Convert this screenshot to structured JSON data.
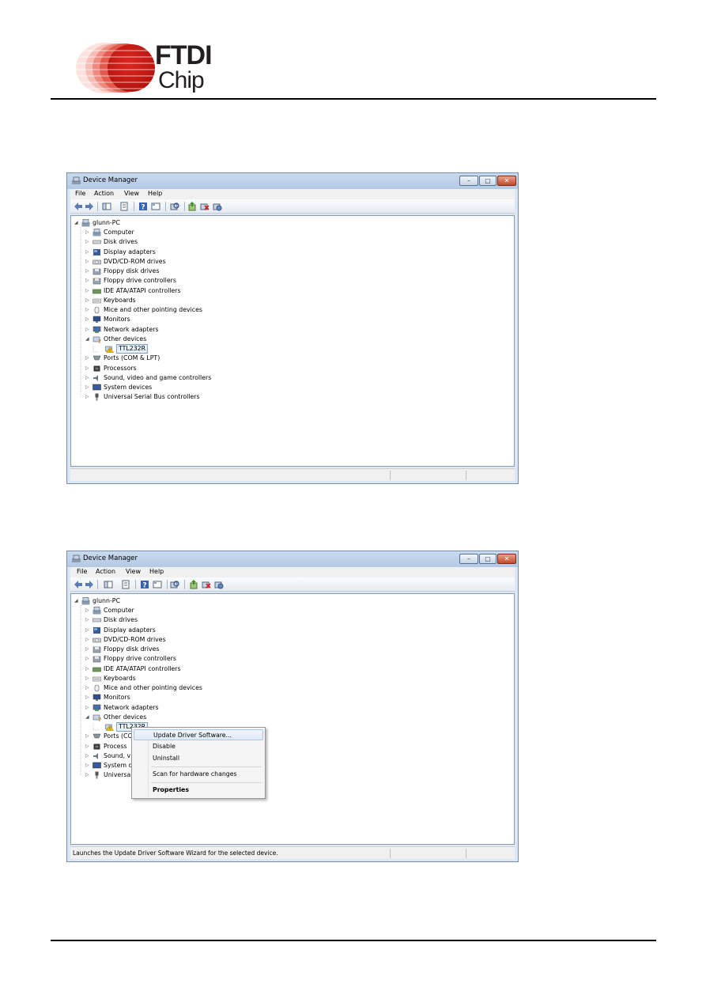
{
  "header": {
    "logo_line1": "FTDI",
    "logo_line2": "Chip",
    "brand_color": "#cc1f1a"
  },
  "window_title": "Device Manager",
  "window_controls": {
    "minimize": "–",
    "maximize": "▢",
    "close": "✕"
  },
  "menu": [
    "File",
    "Action",
    "View",
    "Help"
  ],
  "toolbar_icons": [
    "back-arrow-icon",
    "forward-arrow-icon",
    "show-hide-console-tree-icon",
    "properties-icon",
    "help-icon",
    "view-icon",
    "scan-hardware-icon",
    "update-driver-icon",
    "uninstall-icon",
    "disable-icon"
  ],
  "tree": {
    "root": "glunn-PC",
    "categories": [
      "Computer",
      "Disk drives",
      "Display adapters",
      "DVD/CD-ROM drives",
      "Floppy disk drives",
      "Floppy drive controllers",
      "IDE ATA/ATAPI controllers",
      "Keyboards",
      "Mice and other pointing devices",
      "Monitors",
      "Network adapters",
      "Other devices",
      "Ports (COM & LPT)",
      "Processors",
      "Sound, video and game controllers",
      "System devices",
      "Universal Serial Bus controllers"
    ],
    "child_device": "TTL232R"
  },
  "window2_tree": {
    "categories": [
      "Computer",
      "Disk drives",
      "Display adapters",
      "DVD/CD-ROM drives",
      "Floppy disk drives",
      "Floppy drive controllers",
      "IDE ATA/ATAPI controllers",
      "Keyboards",
      "Mice and other pointing devices",
      "Monitors",
      "Network adapters",
      "Other devices",
      "Ports (CO",
      "Process",
      "Sound, v",
      "System d",
      "Universa"
    ],
    "child_device": "TTL232R"
  },
  "context_menu": {
    "update": "Update Driver Software...",
    "disable": "Disable",
    "uninstall": "Uninstall",
    "scan": "Scan for hardware changes",
    "properties": "Properties"
  },
  "status_text_2": "Launches the Update Driver Software Wizard for the selected device."
}
